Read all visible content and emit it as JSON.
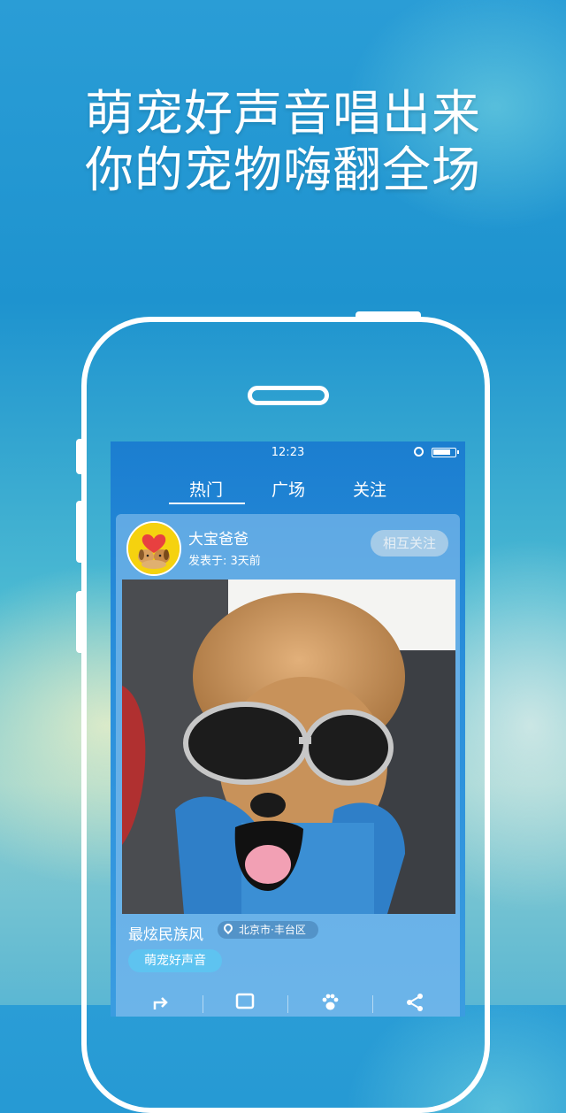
{
  "headline": {
    "line1": "萌宠好声音唱出来",
    "line2": "你的宠物嗨翻全场"
  },
  "status_bar": {
    "time": "12:23"
  },
  "tabs": [
    {
      "label": "热门",
      "active": true
    },
    {
      "label": "广场",
      "active": false
    },
    {
      "label": "关注",
      "active": false
    }
  ],
  "post": {
    "user_name": "大宝爸爸",
    "post_time": "发表于: 3天前",
    "follow_label": "相互关注",
    "song_title": "最炫民族风",
    "location": "北京市·丰台区",
    "tag": "萌宠好声音"
  },
  "actions": [
    "share-forward-icon",
    "comment-icon",
    "paw-icon",
    "share-icon"
  ],
  "colors": {
    "accent": "#5ec3f0",
    "screen_bg": "#2a8fdb"
  }
}
